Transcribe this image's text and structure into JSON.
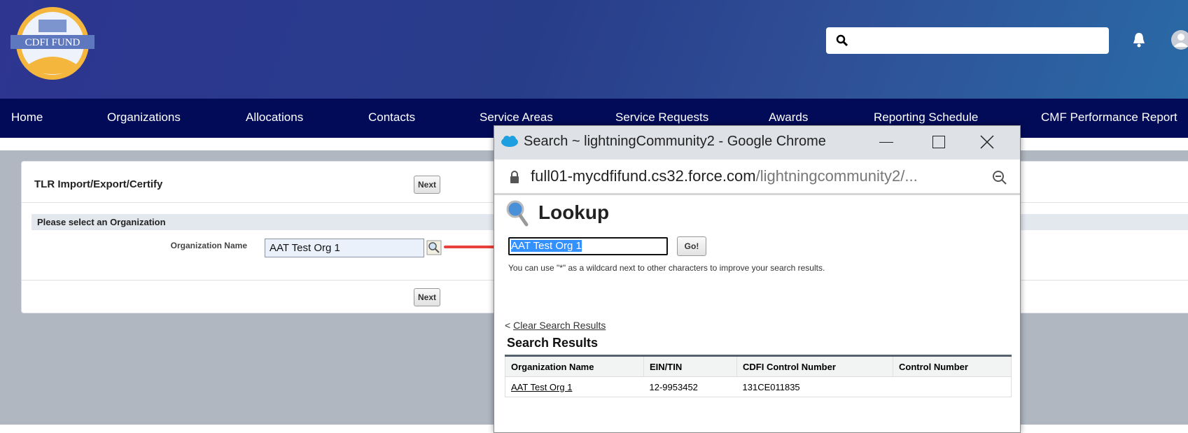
{
  "header": {
    "logo_text": "CDFI FUND",
    "search_placeholder": ""
  },
  "nav": [
    "Home",
    "Organizations",
    "Allocations",
    "Contacts",
    "Service Areas",
    "Service Requests",
    "Awards",
    "Reporting Schedule",
    "CMF Performance Report"
  ],
  "card": {
    "title": "TLR Import/Export/Certify",
    "next_label": "Next",
    "section_title": "Please select an Organization",
    "org_label": "Organization Name",
    "org_value": "AAT Test Org 1"
  },
  "popup": {
    "window_title": "Search ~ lightningCommunity2 - Google Chrome",
    "url_host": "full01-mycdfifund.cs32.force.com",
    "url_path": "/lightningcommunity2/...",
    "heading": "Lookup",
    "search_value": "AAT Test Org 1",
    "go_label": "Go!",
    "hint": "You can use \"*\" as a wildcard next to other characters to improve your search results.",
    "clear_prefix": "<",
    "clear_label": "Clear Search Results",
    "results_title": "Search Results",
    "columns": [
      "Organization Name",
      "EIN/TIN",
      "CDFI Control Number",
      "Control Number"
    ],
    "rows": [
      [
        "AAT Test Org 1",
        "12-9953452",
        "131CE011835",
        ""
      ]
    ]
  },
  "colors": {
    "nav": "#020b57",
    "arrow": "#e8403a",
    "selection": "#3390ff"
  }
}
